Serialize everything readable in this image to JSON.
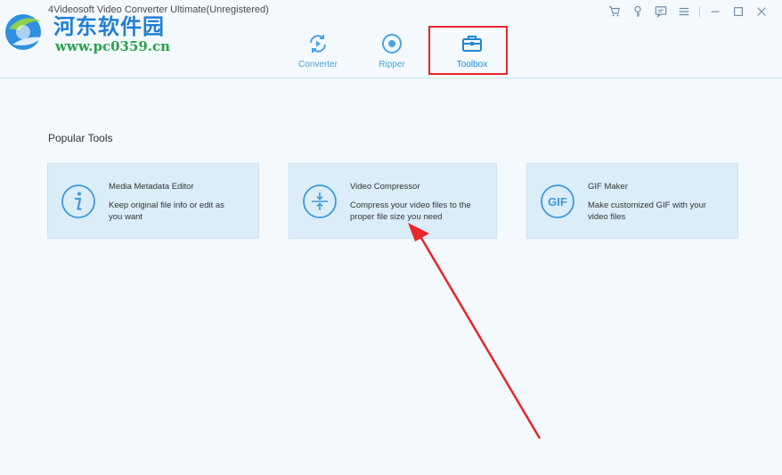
{
  "window": {
    "title": "4Videosoft Video Converter Ultimate(Unregistered)"
  },
  "watermark": {
    "name": "河东软件园",
    "url": "www.pc0359.cn"
  },
  "controls": {
    "icons": [
      "cart-icon",
      "key-icon",
      "chat-icon",
      "menu-icon",
      "minimize-icon",
      "maximize-icon",
      "close-icon"
    ]
  },
  "tabs": [
    {
      "label": "Converter",
      "icon": "converter-icon"
    },
    {
      "label": "Ripper",
      "icon": "ripper-icon"
    },
    {
      "label": "Toolbox",
      "icon": "toolbox-icon",
      "active": true
    }
  ],
  "main": {
    "section_title": "Popular Tools",
    "tools": [
      {
        "name": "Media Metadata Editor",
        "desc": [
          "Keep original file info or edit as",
          "you want"
        ],
        "icon": "info-icon"
      },
      {
        "name": "Video Compressor",
        "desc": [
          "Compress your video files to the",
          "proper file size you need"
        ],
        "icon": "compress-icon"
      },
      {
        "name": "GIF Maker",
        "desc": [
          "Make customized GIF with your",
          "video files"
        ],
        "icon": "gif-icon",
        "icon_text": "GIF"
      }
    ]
  },
  "colors": {
    "accent": "#1e88d4",
    "tab_text": "#4aa3df",
    "card_bg": "#daedf9",
    "highlight": "#e8262b"
  }
}
